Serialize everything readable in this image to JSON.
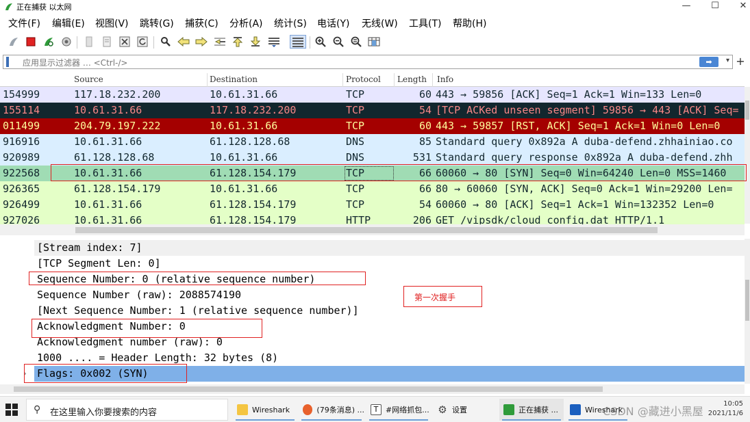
{
  "window": {
    "title": "正在捕获 以太网",
    "minimize": "—",
    "maximize": "☐",
    "close": "✕"
  },
  "menu": [
    "文件(F)",
    "编辑(E)",
    "视图(V)",
    "跳转(G)",
    "捕获(C)",
    "分析(A)",
    "统计(S)",
    "电话(Y)",
    "无线(W)",
    "工具(T)",
    "帮助(H)"
  ],
  "filter": {
    "placeholder": "应用显示过滤器 … <Ctrl-/>",
    "apply_icon": "➡",
    "dropdown_icon": "▾",
    "add_icon": "+"
  },
  "packet_list": {
    "columns": [
      "Source",
      "Destination",
      "Protocol",
      "Length",
      "Info"
    ],
    "rows": [
      {
        "no": "154999",
        "src": "117.18.232.200",
        "dst": "10.61.31.66",
        "proto": "TCP",
        "len": "60",
        "info": "443 → 59856 [ACK] Seq=1 Ack=1 Win=133 Len=0",
        "bg": "#e7e6ff",
        "fg": "#12272e"
      },
      {
        "no": "155114",
        "src": "10.61.31.66",
        "dst": "117.18.232.200",
        "proto": "TCP",
        "len": "54",
        "info": "[TCP ACKed unseen segment] 59856 → 443 [ACK] Seq=",
        "bg": "#12272e",
        "fg": "#f78787"
      },
      {
        "no": "011499",
        "src": "204.79.197.222",
        "dst": "10.61.31.66",
        "proto": "TCP",
        "len": "60",
        "info": "443 → 59857 [RST, ACK] Seq=1 Ack=1 Win=0 Len=0",
        "bg": "#a40000",
        "fg": "#fffc9c"
      },
      {
        "no": "916916",
        "src": "10.61.31.66",
        "dst": "61.128.128.68",
        "proto": "DNS",
        "len": "85",
        "info": "Standard query 0x892a A duba-defend.zhhainiao.co",
        "bg": "#daeeff",
        "fg": "#12272e"
      },
      {
        "no": "920989",
        "src": "61.128.128.68",
        "dst": "10.61.31.66",
        "proto": "DNS",
        "len": "531",
        "info": "Standard query response 0x892a A duba-defend.zhh",
        "bg": "#daeeff",
        "fg": "#12272e"
      },
      {
        "no": "922568",
        "src": "10.61.31.66",
        "dst": "61.128.154.179",
        "proto": "TCP",
        "len": "66",
        "info": "60060 → 80 [SYN] Seq=0 Win=64240 Len=0 MSS=1460",
        "bg": "#a0dcb4",
        "fg": "#12272e"
      },
      {
        "no": "926365",
        "src": "61.128.154.179",
        "dst": "10.61.31.66",
        "proto": "TCP",
        "len": "66",
        "info": "80 → 60060 [SYN, ACK] Seq=0 Ack=1 Win=29200 Len=",
        "bg": "#e4ffc7",
        "fg": "#12272e"
      },
      {
        "no": "926499",
        "src": "10.61.31.66",
        "dst": "61.128.154.179",
        "proto": "TCP",
        "len": "54",
        "info": "60060 → 80 [ACK] Seq=1 Ack=1 Win=132352 Len=0",
        "bg": "#e4ffc7",
        "fg": "#12272e"
      },
      {
        "no": "927026",
        "src": "10.61.31.66",
        "dst": "61.128.154.179",
        "proto": "HTTP",
        "len": "206",
        "info": "GET /vipsdk/cloud_config.dat HTTP/1.1",
        "bg": "#e4ffc7",
        "fg": "#12272e"
      }
    ]
  },
  "details": {
    "lines": [
      "[Stream index: 7]",
      "[TCP Segment Len: 0]",
      "Sequence Number: 0    (relative sequence number)",
      "Sequence Number (raw): 2088574190",
      "[Next Sequence Number: 1    (relative sequence number)]",
      "Acknowledgment Number: 0",
      "Acknowledgment number (raw): 0",
      "1000 .... = Header Length: 32 bytes (8)",
      "Flags: 0x002 (SYN)"
    ],
    "expander": "›",
    "annotation": "第一次握手"
  },
  "taskbar": {
    "search_icon": "⚲",
    "search_text": "在这里输入你要搜索的内容",
    "tasks": [
      {
        "label": "Wireshark",
        "icon_color": "#f4c542"
      },
      {
        "label": "(79条消息) ...",
        "icon_color": "#e8612c"
      },
      {
        "label": "#网络抓包...",
        "icon_color": "#555555"
      },
      {
        "label": "设置",
        "icon_color": "#666666"
      },
      {
        "label": "正在捕获 ...",
        "icon_color": "#2f9b3a"
      },
      {
        "label": "Wireshark",
        "icon_color": "#1b5fbf"
      }
    ],
    "tray_time": "10:05",
    "tray_date": "2021/11/6",
    "watermark": "CSDN @藏进小黑屋"
  },
  "colors": {
    "selection": "#7fb0e8",
    "annotation_red": "#e02020",
    "wireshark_fin": "#1679c9"
  }
}
